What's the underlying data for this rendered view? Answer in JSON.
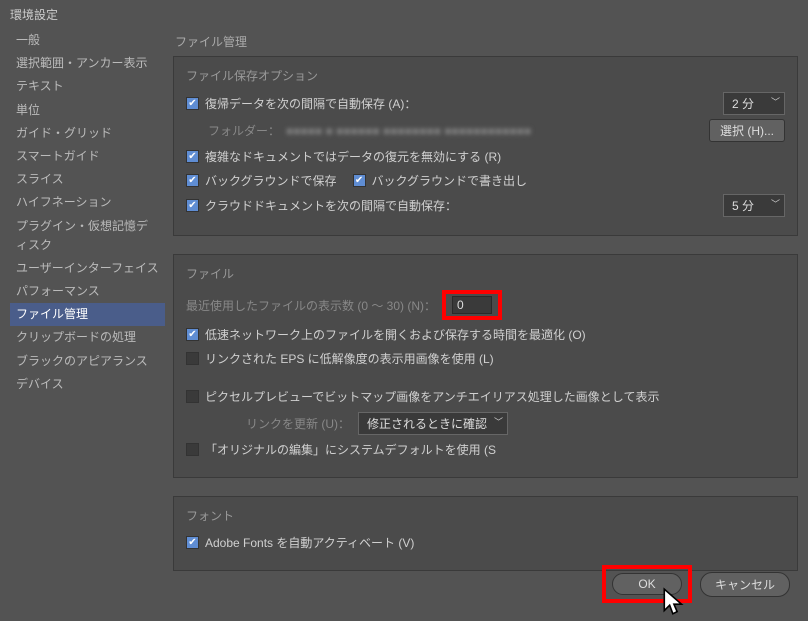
{
  "window": {
    "title": "環境設定"
  },
  "sidebar": {
    "items": [
      "一般",
      "選択範囲・アンカー表示",
      "テキスト",
      "単位",
      "ガイド・グリッド",
      "スマートガイド",
      "スライス",
      "ハイフネーション",
      "プラグイン・仮想記憶ディスク",
      "ユーザーインターフェイス",
      "パフォーマンス",
      "ファイル管理",
      "クリップボードの処理",
      "ブラックのアピアランス",
      "デバイス"
    ],
    "selected_index": 11
  },
  "content": {
    "heading": "ファイル管理",
    "groups": {
      "save": {
        "title": "ファイル保存オプション",
        "recovery_cb": true,
        "recovery_label": "復帰データを次の間隔で自動保存 (A)：",
        "recovery_interval": "2 分",
        "folder_label": "フォルダー：",
        "folder_value": "■■■■■ ■ ■■■■■■ ■■■■■■■■ ■■■■■■■■■■■■",
        "choose_btn": "選択 (H)...",
        "complex_cb": true,
        "complex_label": "複雑なドキュメントではデータの復元を無効にする (R)",
        "bg_save_cb": true,
        "bg_save_label": "バックグラウンドで保存",
        "bg_export_cb": true,
        "bg_export_label": "バックグラウンドで書き出し",
        "cloud_cb": true,
        "cloud_label": "クラウドドキュメントを次の間隔で自動保存：",
        "cloud_interval": "5 分"
      },
      "files": {
        "title": "ファイル",
        "recent_label": "最近使用したファイルの表示数 (0 ～ 30) (N)：",
        "recent_value": "0",
        "slow_net_cb": true,
        "slow_net_label": "低速ネットワーク上のファイルを開くおよび保存する時間を最適化 (O)",
        "eps_cb": false,
        "eps_label": "リンクされた EPS に低解像度の表示用画像を使用 (L)",
        "pixel_cb": false,
        "pixel_label": "ピクセルプレビューでビットマップ画像をアンチエイリアス処理した画像として表示",
        "link_update_label": "リンクを更新 (U)：",
        "link_update_value": "修正されるときに確認",
        "original_cb": false,
        "original_label": "「オリジナルの編集」にシステムデフォルトを使用 (S"
      },
      "fonts": {
        "title": "フォント",
        "auto_activate_cb": true,
        "auto_activate_label": "Adobe Fonts を自動アクティベート (V)"
      }
    }
  },
  "footer": {
    "ok": "OK",
    "cancel": "キャンセル"
  }
}
